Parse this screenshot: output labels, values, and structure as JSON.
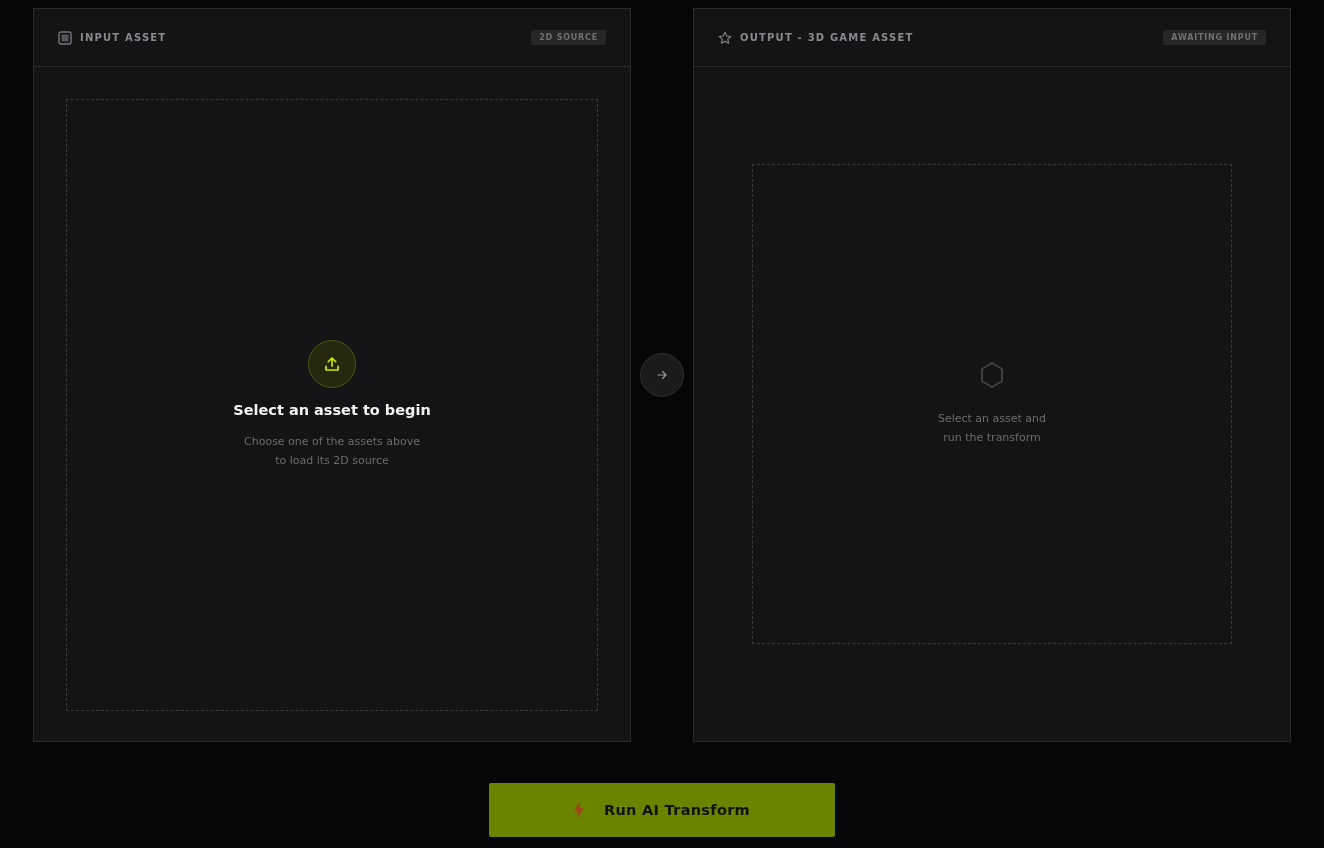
{
  "panels": [
    {
      "kind": "input",
      "title": "INPUT ASSET",
      "badge": "2D SOURCE",
      "heading": "Select an asset to begin",
      "message": "Choose one of the assets above\nto load its 2D source"
    },
    {
      "kind": "output",
      "title": "OUTPUT - 3D GAME ASSET",
      "badge": "AWAITING INPUT",
      "message": "Select an asset and\nrun the transform"
    }
  ],
  "run_button": {
    "label": "Run AI Transform"
  }
}
